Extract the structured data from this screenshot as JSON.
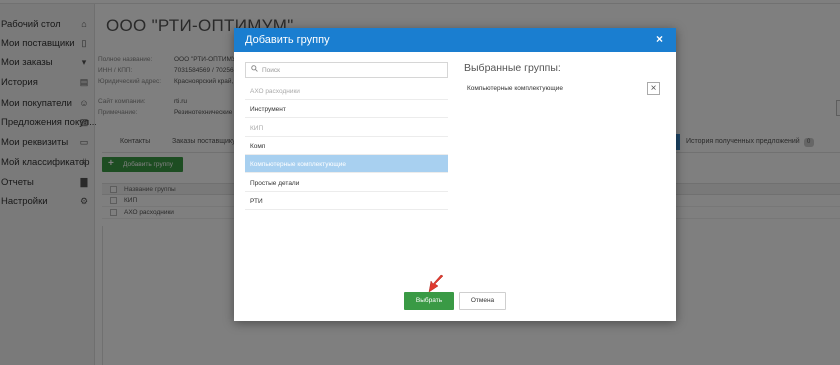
{
  "sidebar": {
    "items": [
      {
        "label": "Рабочий стол",
        "icon": "home-icon",
        "glyph": "⌂"
      },
      {
        "label": "Мои поставщики",
        "icon": "document-icon",
        "glyph": "▯"
      },
      {
        "label": "Мои заказы",
        "icon": "cart-icon",
        "glyph": "▾"
      },
      {
        "label": "История",
        "icon": "basket-icon",
        "glyph": "▤"
      },
      {
        "label": "Мои покупатели",
        "icon": "users-icon",
        "glyph": "☺"
      },
      {
        "label": "Предложения покуп...",
        "icon": "edit-document-icon",
        "glyph": "▨"
      },
      {
        "label": "Мои реквизиты",
        "icon": "card-icon",
        "glyph": "▭"
      },
      {
        "label": "Мой классификатор",
        "icon": "hash-icon",
        "glyph": "#"
      },
      {
        "label": "Отчеты",
        "icon": "report-file-icon",
        "glyph": "▇"
      },
      {
        "label": "Настройки",
        "icon": "gears-icon",
        "glyph": "⚙"
      }
    ]
  },
  "page": {
    "title": "ООО \"РТИ-ОПТИМУМ\"",
    "info": [
      {
        "label": "Полное название:",
        "value": "ООО \"РТИ-ОПТИМУ"
      },
      {
        "label": "ИНН / КПП:",
        "value": "7031584569 / 7025684"
      },
      {
        "label": "Юридический адрес:",
        "value": "Красноярский край, г"
      },
      {
        "label": "Сайт компании:",
        "value": "rti.ru"
      },
      {
        "label": "Примечание:",
        "value": "Резинотехнические из"
      }
    ],
    "tabs": [
      "Контакты",
      "Заказы поставщику"
    ],
    "history_tab": "История полученных предложений",
    "history_badge": "0",
    "add_group_label": "Добавить группу",
    "grid_header": "Название группы",
    "grid_rows": [
      "КИП",
      "АХО расходники"
    ]
  },
  "modal": {
    "title": "Добавить группу",
    "close_glyph": "×",
    "search_placeholder": "Поиск",
    "groups": [
      {
        "label": "АХО расходники",
        "state": "disabled"
      },
      {
        "label": "Инструмент",
        "state": "normal"
      },
      {
        "label": "КИП",
        "state": "disabled"
      },
      {
        "label": "Комп",
        "state": "normal"
      },
      {
        "label": "Компьютерные комплектующие",
        "state": "selected"
      },
      {
        "label": "Простые детали",
        "state": "normal"
      },
      {
        "label": "РТИ",
        "state": "normal"
      }
    ],
    "selected_title": "Выбранные группы:",
    "selected_items": [
      "Компьютерные комплектующие"
    ],
    "choose_label": "Выбрать",
    "cancel_label": "Отмена"
  },
  "colors": {
    "modal_header": "#1a7ed0",
    "primary_button": "#3a9a45",
    "selected_item": "#a8d0f0",
    "arrow": "#e03a2f"
  }
}
